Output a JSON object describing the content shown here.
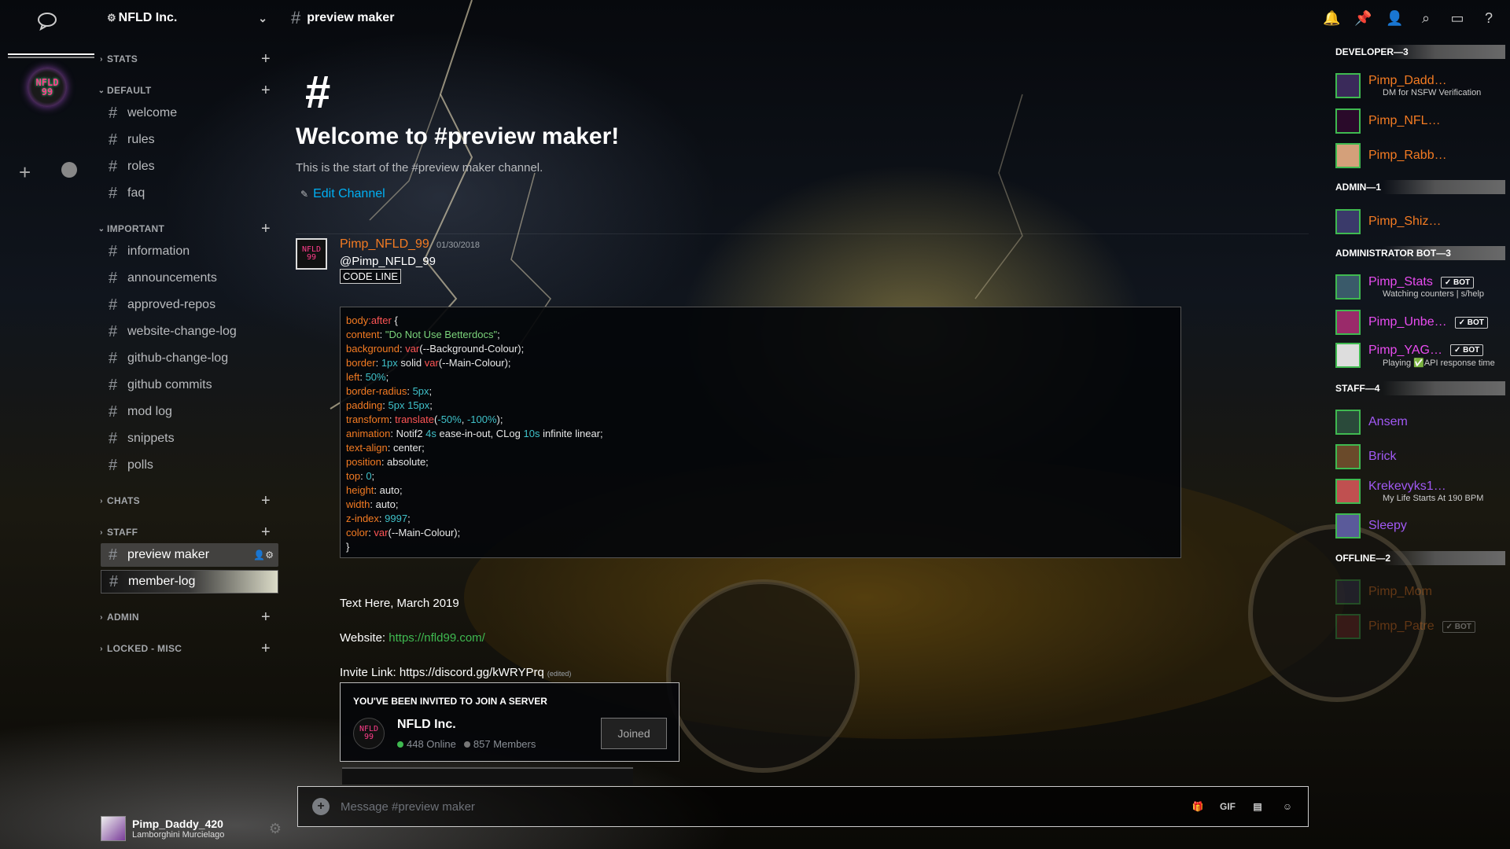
{
  "guild": {
    "name": "NFLD Inc.",
    "icon_text": "NFLD\n99"
  },
  "rail": {
    "add_label": "+"
  },
  "categories": [
    {
      "name": "STATS",
      "caret": "›"
    },
    {
      "name": "DEFAULT",
      "caret": "⌄"
    },
    {
      "name": "IMPORTANT",
      "caret": "⌄"
    },
    {
      "name": "CHATS",
      "caret": "›"
    },
    {
      "name": "STAFF",
      "caret": "›"
    },
    {
      "name": "ADMIN",
      "caret": "›"
    },
    {
      "name": "LOCKED - MISC",
      "caret": "›"
    }
  ],
  "channels": {
    "default": [
      "welcome",
      "rules",
      "roles",
      "faq"
    ],
    "important": [
      "information",
      "announcements",
      "approved-repos",
      "website-change-log",
      "github-change-log",
      "github commits",
      "mod log",
      "snippets",
      "polls"
    ],
    "staff": [
      "preview maker",
      "member-log"
    ]
  },
  "user": {
    "name": "Pimp_Daddy_420",
    "status": "Lamborghini Murcielago"
  },
  "topbar": {
    "channel": "preview maker"
  },
  "welcome": {
    "hash": "#",
    "title": "Welcome to #preview maker!",
    "subtitle": "This is the start of the #preview maker channel.",
    "edit": "Edit Channel"
  },
  "message": {
    "author": "Pimp_NFLD_99",
    "time": "01/30/2018",
    "mention": "@Pimp_NFLD_99",
    "code_label": "CODE LINE",
    "text1": "Text Here, March 2019",
    "website_label": "Website:",
    "website_url": "https://nfld99.com/",
    "invite_label": "Invite Link: https://discord.gg/kWRYPrq",
    "edited": "(edited)"
  },
  "code": [
    {
      "parts": [
        [
          "k",
          "body"
        ],
        [
          "f",
          ":after"
        ],
        [
          "v",
          " {"
        ]
      ]
    },
    {
      "parts": [
        [
          "k",
          "content"
        ],
        [
          "v",
          ": "
        ],
        [
          "s",
          "\"Do Not Use Betterdocs\""
        ],
        [
          "v",
          ";"
        ]
      ]
    },
    {
      "parts": [
        [
          "k",
          "background"
        ],
        [
          "v",
          ": "
        ],
        [
          "f",
          "var"
        ],
        [
          "v",
          "(--Background-Colour);"
        ]
      ]
    },
    {
      "parts": [
        [
          "k",
          "border"
        ],
        [
          "v",
          ": "
        ],
        [
          "n",
          "1px"
        ],
        [
          "v",
          " solid "
        ],
        [
          "f",
          "var"
        ],
        [
          "v",
          "(--Main-Colour);"
        ]
      ]
    },
    {
      "parts": [
        [
          "k",
          "left"
        ],
        [
          "v",
          ": "
        ],
        [
          "n",
          "50%"
        ],
        [
          "v",
          ";"
        ]
      ]
    },
    {
      "parts": [
        [
          "k",
          "border-radius"
        ],
        [
          "v",
          ": "
        ],
        [
          "n",
          "5px"
        ],
        [
          "v",
          ";"
        ]
      ]
    },
    {
      "parts": [
        [
          "k",
          "padding"
        ],
        [
          "v",
          ": "
        ],
        [
          "n",
          "5px 15px"
        ],
        [
          "v",
          ";"
        ]
      ]
    },
    {
      "parts": [
        [
          "k",
          "transform"
        ],
        [
          "v",
          ": "
        ],
        [
          "f",
          "translate"
        ],
        [
          "v",
          "("
        ],
        [
          "n",
          "-50%"
        ],
        [
          "v",
          ", "
        ],
        [
          "n",
          "-100%"
        ],
        [
          "v",
          ");"
        ]
      ]
    },
    {
      "parts": [
        [
          "k",
          "animation"
        ],
        [
          "v",
          ": Notif2 "
        ],
        [
          "n",
          "4s"
        ],
        [
          "v",
          " ease-in-out, CLog "
        ],
        [
          "n",
          "10s"
        ],
        [
          "v",
          " infinite linear;"
        ]
      ]
    },
    {
      "parts": [
        [
          "k",
          "text-align"
        ],
        [
          "v",
          ": center;"
        ]
      ]
    },
    {
      "parts": [
        [
          "k",
          "position"
        ],
        [
          "v",
          ": absolute;"
        ]
      ]
    },
    {
      "parts": [
        [
          "k",
          "top"
        ],
        [
          "v",
          ": "
        ],
        [
          "n",
          "0"
        ],
        [
          "v",
          ";"
        ]
      ]
    },
    {
      "parts": [
        [
          "k",
          "height"
        ],
        [
          "v",
          ": auto;"
        ]
      ]
    },
    {
      "parts": [
        [
          "k",
          "width"
        ],
        [
          "v",
          ": auto;"
        ]
      ]
    },
    {
      "parts": [
        [
          "k",
          "z-index"
        ],
        [
          "v",
          ": "
        ],
        [
          "n",
          "9997"
        ],
        [
          "v",
          ";"
        ]
      ]
    },
    {
      "parts": [
        [
          "k",
          "color"
        ],
        [
          "v",
          ": "
        ],
        [
          "f",
          "var"
        ],
        [
          "v",
          "(--Main-Colour);"
        ]
      ]
    },
    {
      "parts": [
        [
          "v",
          "}"
        ]
      ]
    }
  ],
  "invite": {
    "header": "YOU'VE BEEN INVITED TO JOIN A SERVER",
    "name": "NFLD Inc.",
    "online": "448 Online",
    "members": "857 Members",
    "button": "Joined"
  },
  "composer": {
    "placeholder": "Message #preview maker"
  },
  "roles": [
    {
      "name": "DEVELOPER—3"
    },
    {
      "name": "ADMIN—1"
    },
    {
      "name": "ADMINISTRATOR BOT—3"
    },
    {
      "name": "STAFF—4"
    },
    {
      "name": "OFFLINE—2"
    }
  ],
  "members": [
    {
      "name": "Pimp_Dadd…",
      "activity": "DM for NSFW Verification",
      "color": "#f47b22"
    },
    {
      "name": "Pimp_NFL…",
      "activity": "",
      "color": "#f47b22"
    },
    {
      "name": "Pimp_Rabb…",
      "activity": "",
      "color": "#f47b22"
    },
    {
      "name": "Pimp_Shiz…",
      "activity": "",
      "color": "#f47b22"
    },
    {
      "name": "Pimp_Stats",
      "activity": "Watching counters | s/help",
      "color": "#e94cf0",
      "bot": "✓ BOT"
    },
    {
      "name": "Pimp_Unbe…",
      "activity": "",
      "color": "#e94cf0",
      "bot": "✓ BOT"
    },
    {
      "name": "Pimp_YAG…",
      "activity": "Playing ✅API response time",
      "color": "#e94cf0",
      "bot": "✓ BOT"
    },
    {
      "name": "Ansem",
      "activity": "",
      "color": "#a159f4"
    },
    {
      "name": "Brick",
      "activity": "",
      "color": "#a159f4"
    },
    {
      "name": "Krekevyks1…",
      "activity": "My Life Starts At 190 BPM",
      "color": "#a159f4"
    },
    {
      "name": "Sleepy",
      "activity": "",
      "color": "#a159f4"
    },
    {
      "name": "Pimp_Mom",
      "activity": "",
      "color": "#f47b22"
    },
    {
      "name": "Pimp_Patre",
      "activity": "",
      "color": "#f47b22",
      "bot": "✓ BOT"
    }
  ]
}
